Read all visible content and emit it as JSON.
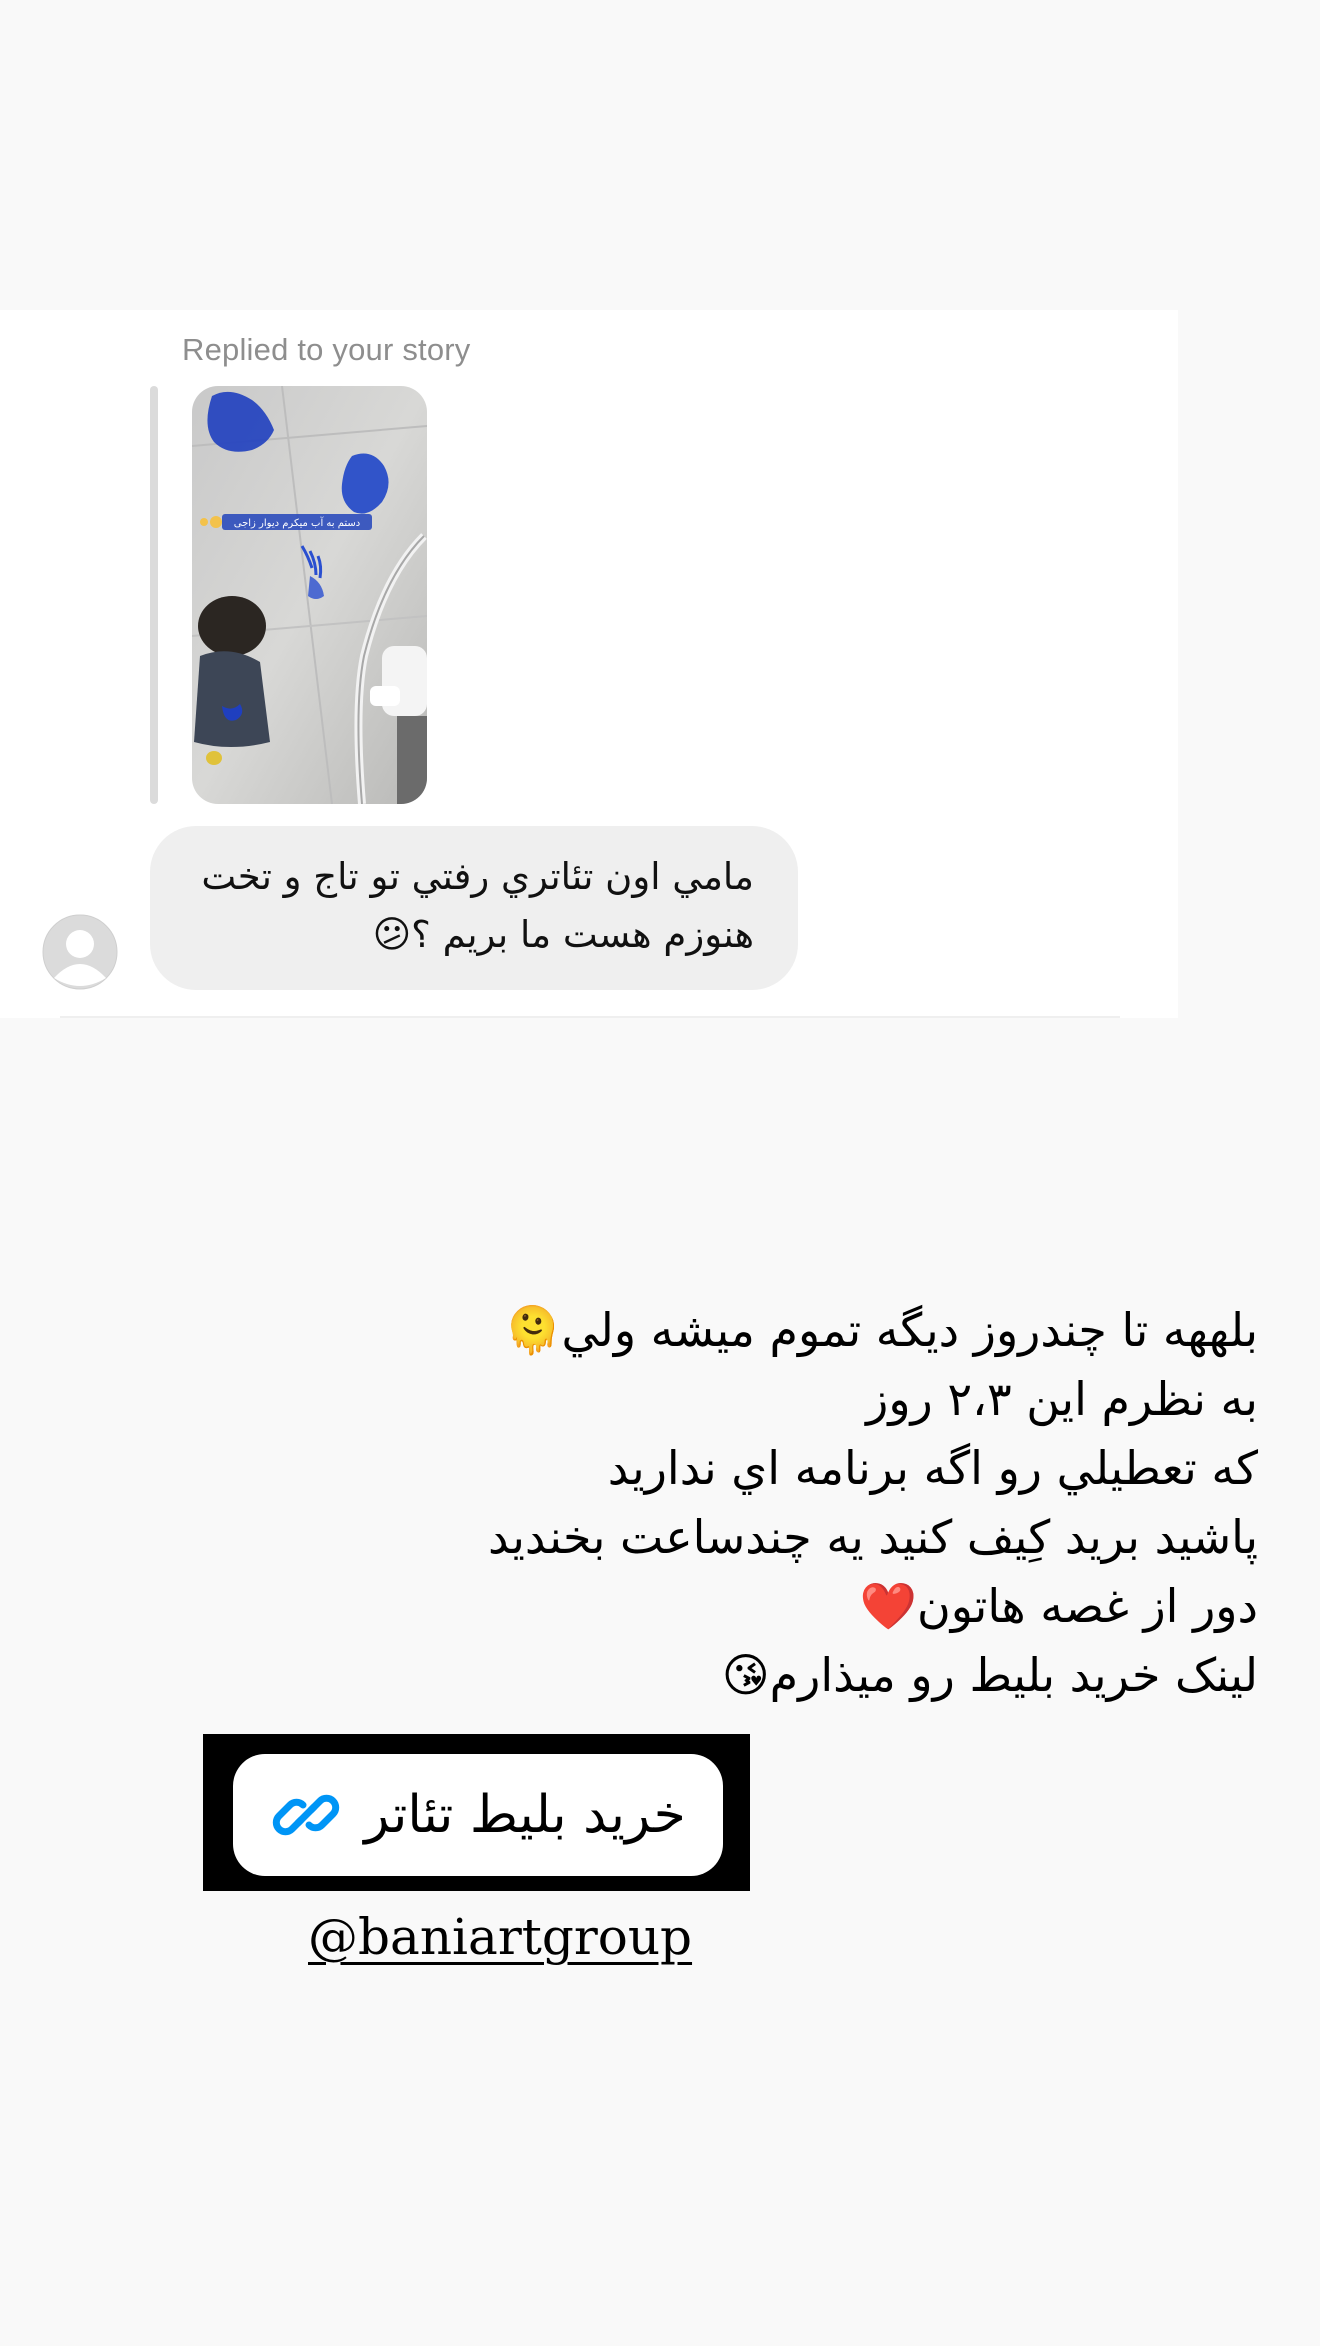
{
  "reply": {
    "label": "Replied to your story",
    "message_lines": [
      "مامي اون تئاتري رفتي تو تاج و تخت",
      "هنوزم هست ما بريم ؟😕"
    ],
    "thumbnail_caption": "دستم به آب میکرم دیوار زاجی"
  },
  "story": {
    "lines": [
      "بلههه تا چندروز ديگه تموم ميشه ولي🫠",
      "به نظرم اين ۲،۳ روز",
      " که تعطيلي رو اگه برنامه اي نداريد",
      "پاشيد بريد کِيف کنيد يه چندساعت بخنديد",
      "دور از غصه هاتون❤️",
      "لينک خريد بليط رو ميذارم😘"
    ]
  },
  "link_sticker": {
    "label": "خرید بلیط تئاتر",
    "icon": "link-icon",
    "icon_color": "#0095f6"
  },
  "mention": {
    "handle": "@baniartgroup"
  },
  "colors": {
    "page_background": "#f9f9f9",
    "card_background": "#ffffff",
    "bubble_background": "#efefef",
    "muted_text": "#8e8e8e",
    "link_accent": "#0095f6"
  }
}
